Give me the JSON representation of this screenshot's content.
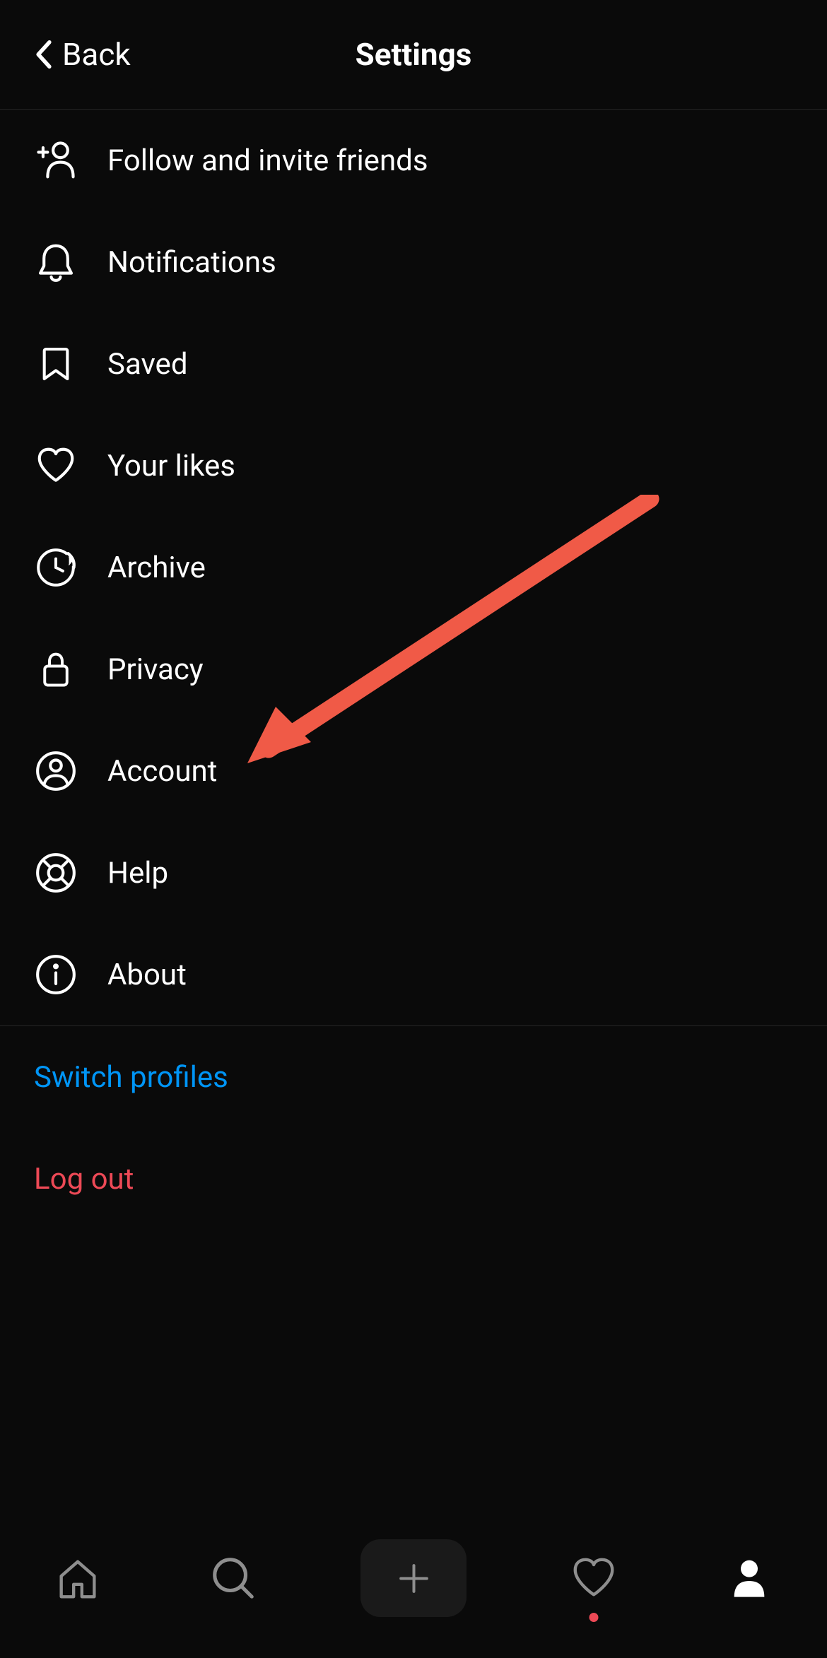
{
  "header": {
    "back_label": "Back",
    "title": "Settings"
  },
  "menu": {
    "items": [
      {
        "label": "Follow and invite friends",
        "icon": "add-person"
      },
      {
        "label": "Notifications",
        "icon": "bell"
      },
      {
        "label": "Saved",
        "icon": "bookmark"
      },
      {
        "label": "Your likes",
        "icon": "heart"
      },
      {
        "label": "Archive",
        "icon": "archive"
      },
      {
        "label": "Privacy",
        "icon": "lock"
      },
      {
        "label": "Account",
        "icon": "account"
      },
      {
        "label": "Help",
        "icon": "lifebuoy"
      },
      {
        "label": "About",
        "icon": "info"
      }
    ]
  },
  "actions": {
    "switch_profiles": "Switch profiles",
    "logout": "Log out"
  },
  "colors": {
    "accent_blue": "#0095f6",
    "accent_red": "#ed4956",
    "annotation_arrow": "#f05a47"
  },
  "annotation": {
    "arrow_points_to": "Account"
  }
}
